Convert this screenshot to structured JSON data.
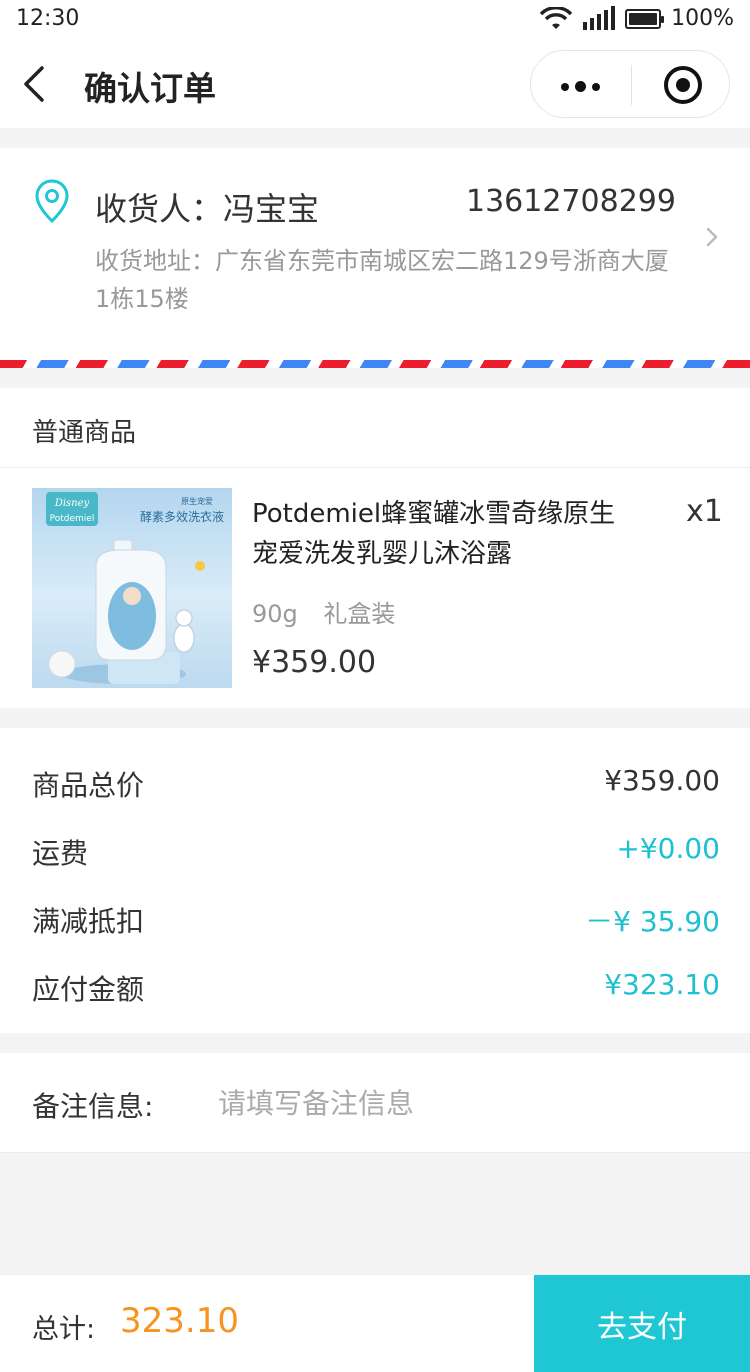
{
  "status": {
    "time": "12:30",
    "battery": "100%"
  },
  "nav": {
    "title": "确认订单"
  },
  "address": {
    "receiver": "收货人：冯宝宝",
    "phone": "13612708299",
    "detail": "收货地址：广东省东莞市南城区宏二路129号浙商大厦1栋15楼"
  },
  "goods": {
    "section_title": "普通商品",
    "items": [
      {
        "name": "Potdemiel蜂蜜罐冰雪奇缘原生宠爱洗发乳婴儿沐浴露",
        "qty": "x1",
        "spec": "90g 礼盒装",
        "price": "¥359.00",
        "image_text": {
          "brand1": "Disney",
          "brand2": "Potdemiel",
          "line1": "原生宠爱",
          "line2": "酵素多效洗衣液"
        }
      }
    ]
  },
  "summary": {
    "rows": [
      {
        "label": "商品总价",
        "value": "¥359.00"
      },
      {
        "label": "运费",
        "value": "+¥0.00"
      },
      {
        "label": "满减抵扣",
        "value": "－¥ 35.90"
      },
      {
        "label": "应付金额",
        "value": "¥323.10"
      }
    ]
  },
  "remark": {
    "label": "备注信息:",
    "placeholder": "请填写备注信息"
  },
  "footer": {
    "total_label": "总计:",
    "total_value": "323.10",
    "pay_label": "去支付"
  },
  "colors": {
    "accent": "#1fc6d3",
    "total": "#f7931e",
    "teal_text": "#1fc0cf"
  }
}
